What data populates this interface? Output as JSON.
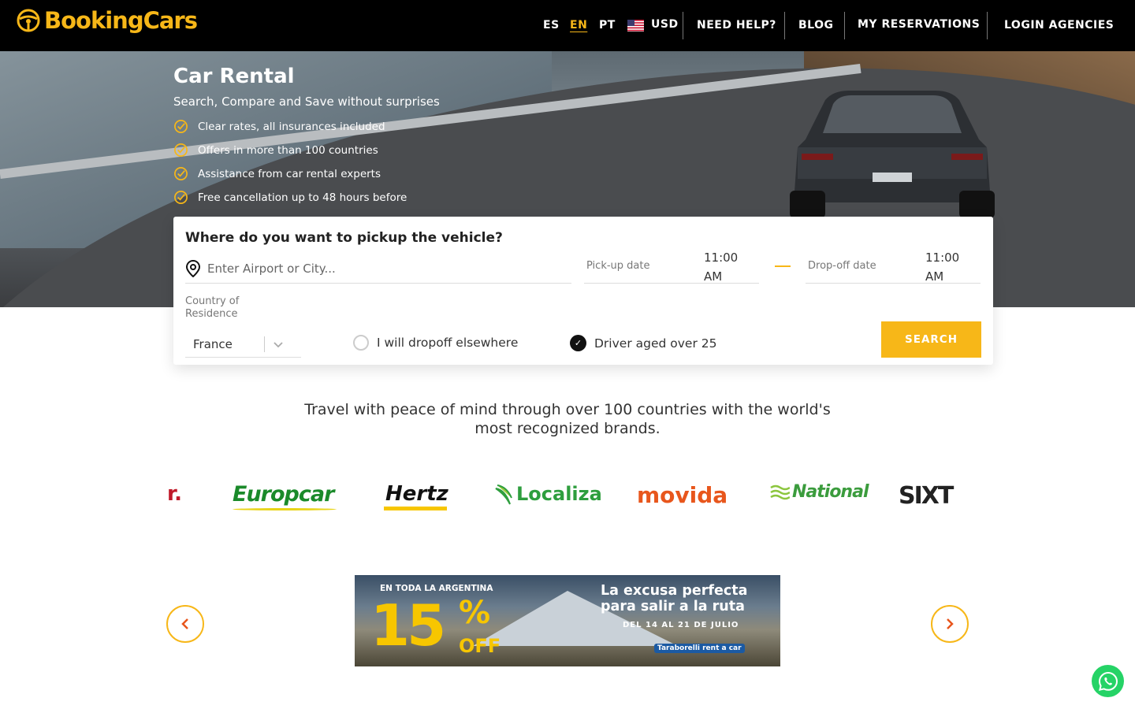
{
  "header": {
    "logo_text": "BookingCars",
    "languages": [
      "ES",
      "EN",
      "PT"
    ],
    "active_language": "EN",
    "currency": "USD",
    "links": {
      "help": "NEED HELP?",
      "blog": "BLOG",
      "reservations": "MY RESERVATIONS",
      "agencies": "LOGIN AGENCIES"
    }
  },
  "hero": {
    "title": "Car Rental",
    "subtitle": "Search, Compare and Save without surprises",
    "features": [
      "Clear rates, all insurances included",
      "Offers in more than 100 countries",
      "Assistance from car rental experts",
      "Free cancellation up to 48 hours before"
    ]
  },
  "search": {
    "title": "Where do you want to pickup the vehicle?",
    "location_placeholder": "Enter Airport or City...",
    "pickup_label": "Pick-up date",
    "pickup_time": "11:00 AM",
    "dropoff_label": "Drop-off date",
    "dropoff_time": "11:00 AM",
    "country_label": "Country of Residence",
    "country_value": "France",
    "dropoff_elsewhere": "I will dropoff elsewhere",
    "driver_age": "Driver aged over 25",
    "button": "SEARCH"
  },
  "tagline": "Travel with peace of mind through over 100 countries with the world's most recognized brands.",
  "brands": {
    "partial": "r.",
    "europcar": "Europcar",
    "hertz": "Hertz",
    "localiza": "Localiza",
    "movida": "movida",
    "national": "National",
    "sixt": "SIXT"
  },
  "banner": {
    "small": "EN TODA LA ARGENTINA",
    "big": "15",
    "percent": "%",
    "off": "OFF",
    "headline": "La excusa perfecta para salir a la ruta",
    "dates": "DEL 14 AL 21 DE JULIO",
    "brand": "Taraborelli rent a car"
  },
  "colors": {
    "accent": "#f7b718",
    "nav_bg": "#000000",
    "whatsapp": "#25d366"
  }
}
